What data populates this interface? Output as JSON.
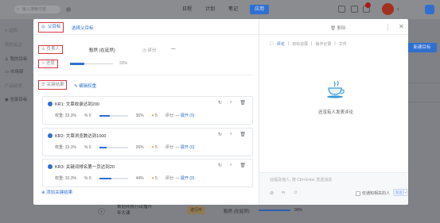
{
  "topbar": {
    "search_placeholder": "输入搜索内容",
    "nav": [
      "日程",
      "计划",
      "笔记",
      "应用"
    ],
    "active_nav_index": 3
  },
  "left_panel": {
    "items": [
      "< 返回",
      "我的关注",
      "我的目标",
      "市场部",
      "产品研发",
      "全部目标"
    ]
  },
  "right_panel": {
    "new_goal_button": "新建目标"
  },
  "background_row": {
    "number": "1",
    "title": "策划并执行目播开年大课",
    "tag": "进行中",
    "owner": "魁然 (在延然)",
    "progress_text": "90%"
  },
  "modal": {
    "parent_goal_label": "父目标",
    "select_parent_link": "选择父目标",
    "owner_label": "负责人",
    "owner_name": "魁然 (在延然)",
    "score_label": "评分",
    "score_value": "—",
    "progress_label": "进度",
    "progress_value": 0.33,
    "progress_text": "33%",
    "key_results_label": "关键结果",
    "edit_weight_link": "编辑权重",
    "key_results": [
      {
        "title": "KR1: 文章收录达到200",
        "weight": "权重: 33.3%",
        "start": "% 0",
        "progress": 0.36,
        "progress_text": "36%",
        "likes": "5",
        "score": "评分: —",
        "expand": "展开 (0)"
      },
      {
        "title": "KR2: 文章浏览数达到1000",
        "weight": "权重: 33.3%",
        "start": "% 0",
        "progress": 0.26,
        "progress_text": "26%",
        "likes": "5",
        "score": "评分: —",
        "expand": "展开 (0)"
      },
      {
        "title": "KR3: 关键词排名第一页达到20",
        "weight": "权重: 33.3%",
        "start": "% 0",
        "progress": 0.44,
        "progress_text": "44%",
        "likes": "5",
        "score": "评分: —",
        "expand": "展开 (0)"
      }
    ],
    "add_kr_link": "添加关键结果",
    "delete_label": "删除",
    "right_tabs": [
      "评论",
      "目标进展",
      "操作记录",
      "文件"
    ],
    "active_right_tab": 0,
    "no_comment_text": "还没有人发表评论",
    "comment_placeholder": "@提及他人, 按 Ctrl+Enter 发送消息",
    "notify_label": "仅通知相关的人",
    "send_label": "发送"
  },
  "colors": {
    "accent": "#2f6fd1",
    "highlight_box": "#d9363e",
    "like": "#f0a020"
  }
}
